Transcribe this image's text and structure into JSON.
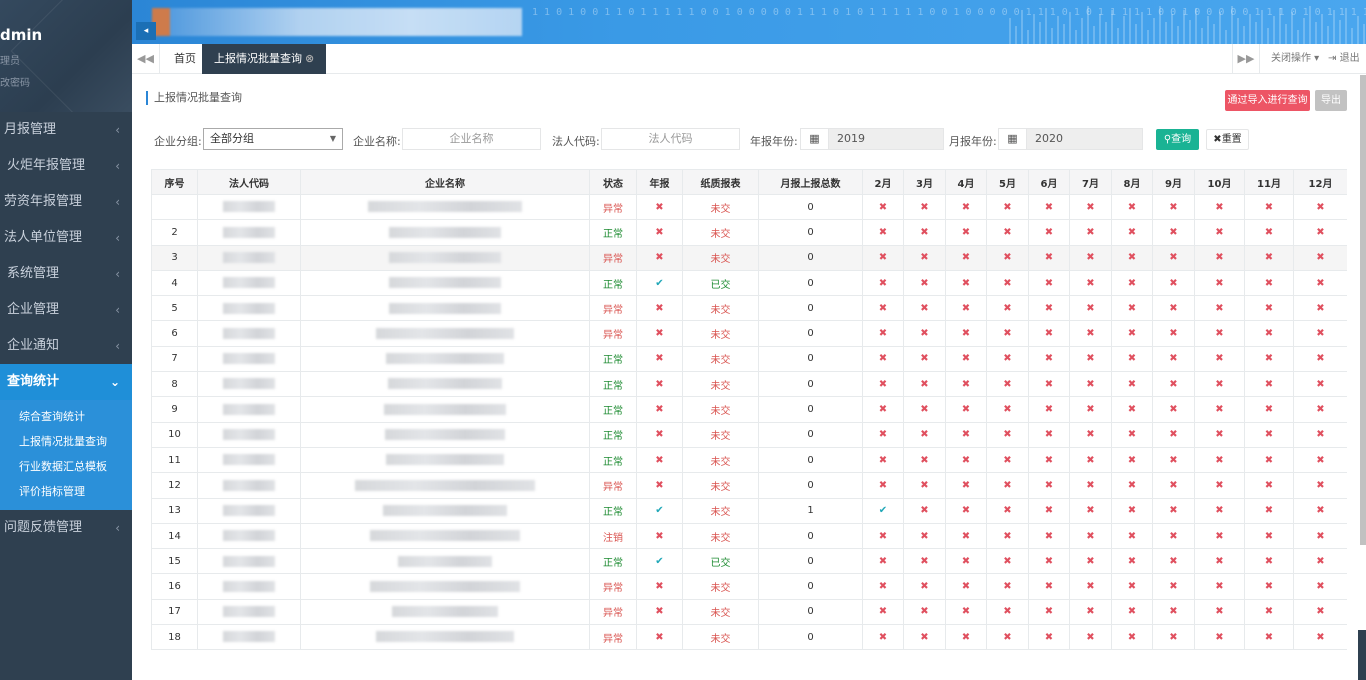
{
  "sidebar": {
    "user": "dmin",
    "role": "理员",
    "change_pwd": "改密码",
    "items": [
      {
        "label": "月报管理"
      },
      {
        "label": "火炬年报管理"
      },
      {
        "label": "劳资年报管理"
      },
      {
        "label": "法人单位管理"
      },
      {
        "label": "系统管理"
      },
      {
        "label": "企业管理"
      },
      {
        "label": "企业通知"
      },
      {
        "label": "查询统计"
      },
      {
        "label": "问题反馈管理"
      }
    ],
    "submenu": [
      "综合查询统计",
      "上报情况批量查询",
      "行业数据汇总模板",
      "评价指标管理"
    ]
  },
  "banner": {
    "bits": "1 1 0 1 0 0 1 1 0 1 1 1 1 1 0 0 1 0 0 0 0 0 1 1 1 0 1 0 1 1 1 1 1 0 0 1 0 0 0 0 0 1 1 1 0 1 0 1 1 1 1 1 0 0 1 0 0 0 0 0 1 1 1 0 1 0 1 1 1 1 1 0 0 1 0 0 0 0 0 1 1 1 0 1 0 1 1 1 1 1 0 0 1"
  },
  "tabs": {
    "home": "首页",
    "current": "上报情况批量查询",
    "close_ops": "关闭操作",
    "logout": "退出"
  },
  "page": {
    "title": "上报情况批量查询",
    "import_btn": "通过导入进行查询",
    "export_btn": "导出"
  },
  "filters": {
    "group_label": "企业分组:",
    "group_value": "全部分组",
    "name_label": "企业名称:",
    "name_placeholder": "企业名称",
    "code_label": "法人代码:",
    "code_placeholder": "法人代码",
    "year_label": "年报年份:",
    "year_value": "2019",
    "month_year_label": "月报年份:",
    "month_year_value": "2020",
    "query_btn": "查询",
    "reset_btn": "重置"
  },
  "table": {
    "headers": [
      "序号",
      "法人代码",
      "企业名称",
      "状态",
      "年报",
      "纸质报表",
      "月报上报总数",
      "2月",
      "3月",
      "4月",
      "5月",
      "6月",
      "7月",
      "8月",
      "9月",
      "10月",
      "11月",
      "12月"
    ],
    "rows": [
      {
        "no": "",
        "status": "异常",
        "annual": false,
        "paper": "未交",
        "total": "0",
        "feb": false
      },
      {
        "no": "2",
        "status": "正常",
        "annual": false,
        "paper": "未交",
        "total": "0",
        "feb": false
      },
      {
        "no": "3",
        "status": "异常",
        "annual": false,
        "paper": "未交",
        "total": "0",
        "feb": false
      },
      {
        "no": "4",
        "status": "正常",
        "annual": true,
        "paper": "已交",
        "total": "0",
        "feb": false
      },
      {
        "no": "5",
        "status": "异常",
        "annual": false,
        "paper": "未交",
        "total": "0",
        "feb": false
      },
      {
        "no": "6",
        "status": "异常",
        "annual": false,
        "paper": "未交",
        "total": "0",
        "feb": false
      },
      {
        "no": "7",
        "status": "正常",
        "annual": false,
        "paper": "未交",
        "total": "0",
        "feb": false
      },
      {
        "no": "8",
        "status": "正常",
        "annual": false,
        "paper": "未交",
        "total": "0",
        "feb": false
      },
      {
        "no": "9",
        "status": "正常",
        "annual": false,
        "paper": "未交",
        "total": "0",
        "feb": false
      },
      {
        "no": "10",
        "status": "正常",
        "annual": false,
        "paper": "未交",
        "total": "0",
        "feb": false
      },
      {
        "no": "11",
        "status": "正常",
        "annual": false,
        "paper": "未交",
        "total": "0",
        "feb": false
      },
      {
        "no": "12",
        "status": "异常",
        "annual": false,
        "paper": "未交",
        "total": "0",
        "feb": false
      },
      {
        "no": "13",
        "status": "正常",
        "annual": true,
        "paper": "未交",
        "total": "1",
        "feb": true
      },
      {
        "no": "14",
        "status": "注销",
        "annual": false,
        "paper": "未交",
        "total": "0",
        "feb": false
      },
      {
        "no": "15",
        "status": "正常",
        "annual": true,
        "paper": "已交",
        "total": "0",
        "feb": false
      },
      {
        "no": "16",
        "status": "异常",
        "annual": false,
        "paper": "未交",
        "total": "0",
        "feb": false
      },
      {
        "no": "17",
        "status": "异常",
        "annual": false,
        "paper": "未交",
        "total": "0",
        "feb": false
      },
      {
        "no": "18",
        "status": "异常",
        "annual": false,
        "paper": "未交",
        "total": "0",
        "feb": false
      }
    ]
  },
  "colors": {
    "sidebar_bg": "#2f4050",
    "active_blue": "#1f8fd8",
    "danger": "#ed5565",
    "success": "#1ab394",
    "ok_green": "#1c8b30",
    "cross_red": "#e0505f",
    "check_teal": "#22a8b8"
  }
}
